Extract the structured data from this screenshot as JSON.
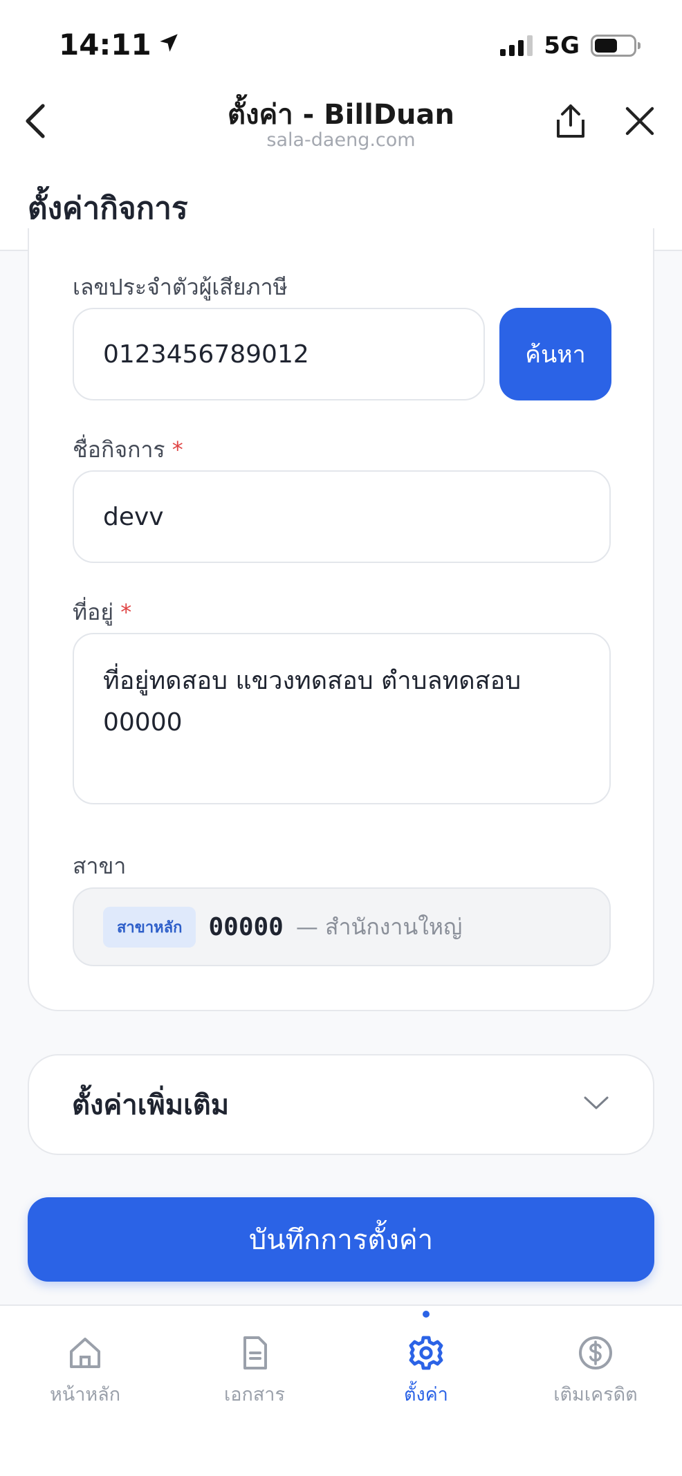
{
  "status_bar": {
    "time": "14:11",
    "network": "5G"
  },
  "browser_header": {
    "title": "ตั้งค่า - BillDuan",
    "domain": "sala-daeng.com",
    "icons": [
      "back-chevron-icon",
      "share-icon",
      "close-icon"
    ]
  },
  "page": {
    "title": "ตั้งค่ากิจการ"
  },
  "form": {
    "tax_id": {
      "label": "เลขประจำตัวผู้เสียภาษี",
      "value": "0123456789012",
      "search_label": "ค้นหา"
    },
    "business_name": {
      "label": "ชื่อกิจการ",
      "required_mark": "*",
      "value": "devv"
    },
    "address": {
      "label": "ที่อยู่",
      "required_mark": "*",
      "line1": "ที่อยู่ทดสอบ แขวงทดสอบ ตำบลทดสอบ",
      "line2": "00000"
    },
    "branch": {
      "label": "สาขา",
      "badge": "สาขาหลัก",
      "code": "00000",
      "name": "— สำนักงานใหญ่"
    }
  },
  "more_settings": {
    "label": "ตั้งค่าเพิ่มเติม"
  },
  "save_button": {
    "label": "บันทึกการตั้งค่า"
  },
  "bottom_nav": {
    "items": [
      {
        "label": "หน้าหลัก",
        "icon": "home-icon"
      },
      {
        "label": "เอกสาร",
        "icon": "document-icon"
      },
      {
        "label": "ตั้งค่า",
        "icon": "gear-icon",
        "active": true
      },
      {
        "label": "เติมเครดิต",
        "icon": "dollar-icon"
      }
    ]
  },
  "colors": {
    "accent": "#2b63e6",
    "required": "#e04545",
    "badge_bg": "#dfe9fb"
  }
}
